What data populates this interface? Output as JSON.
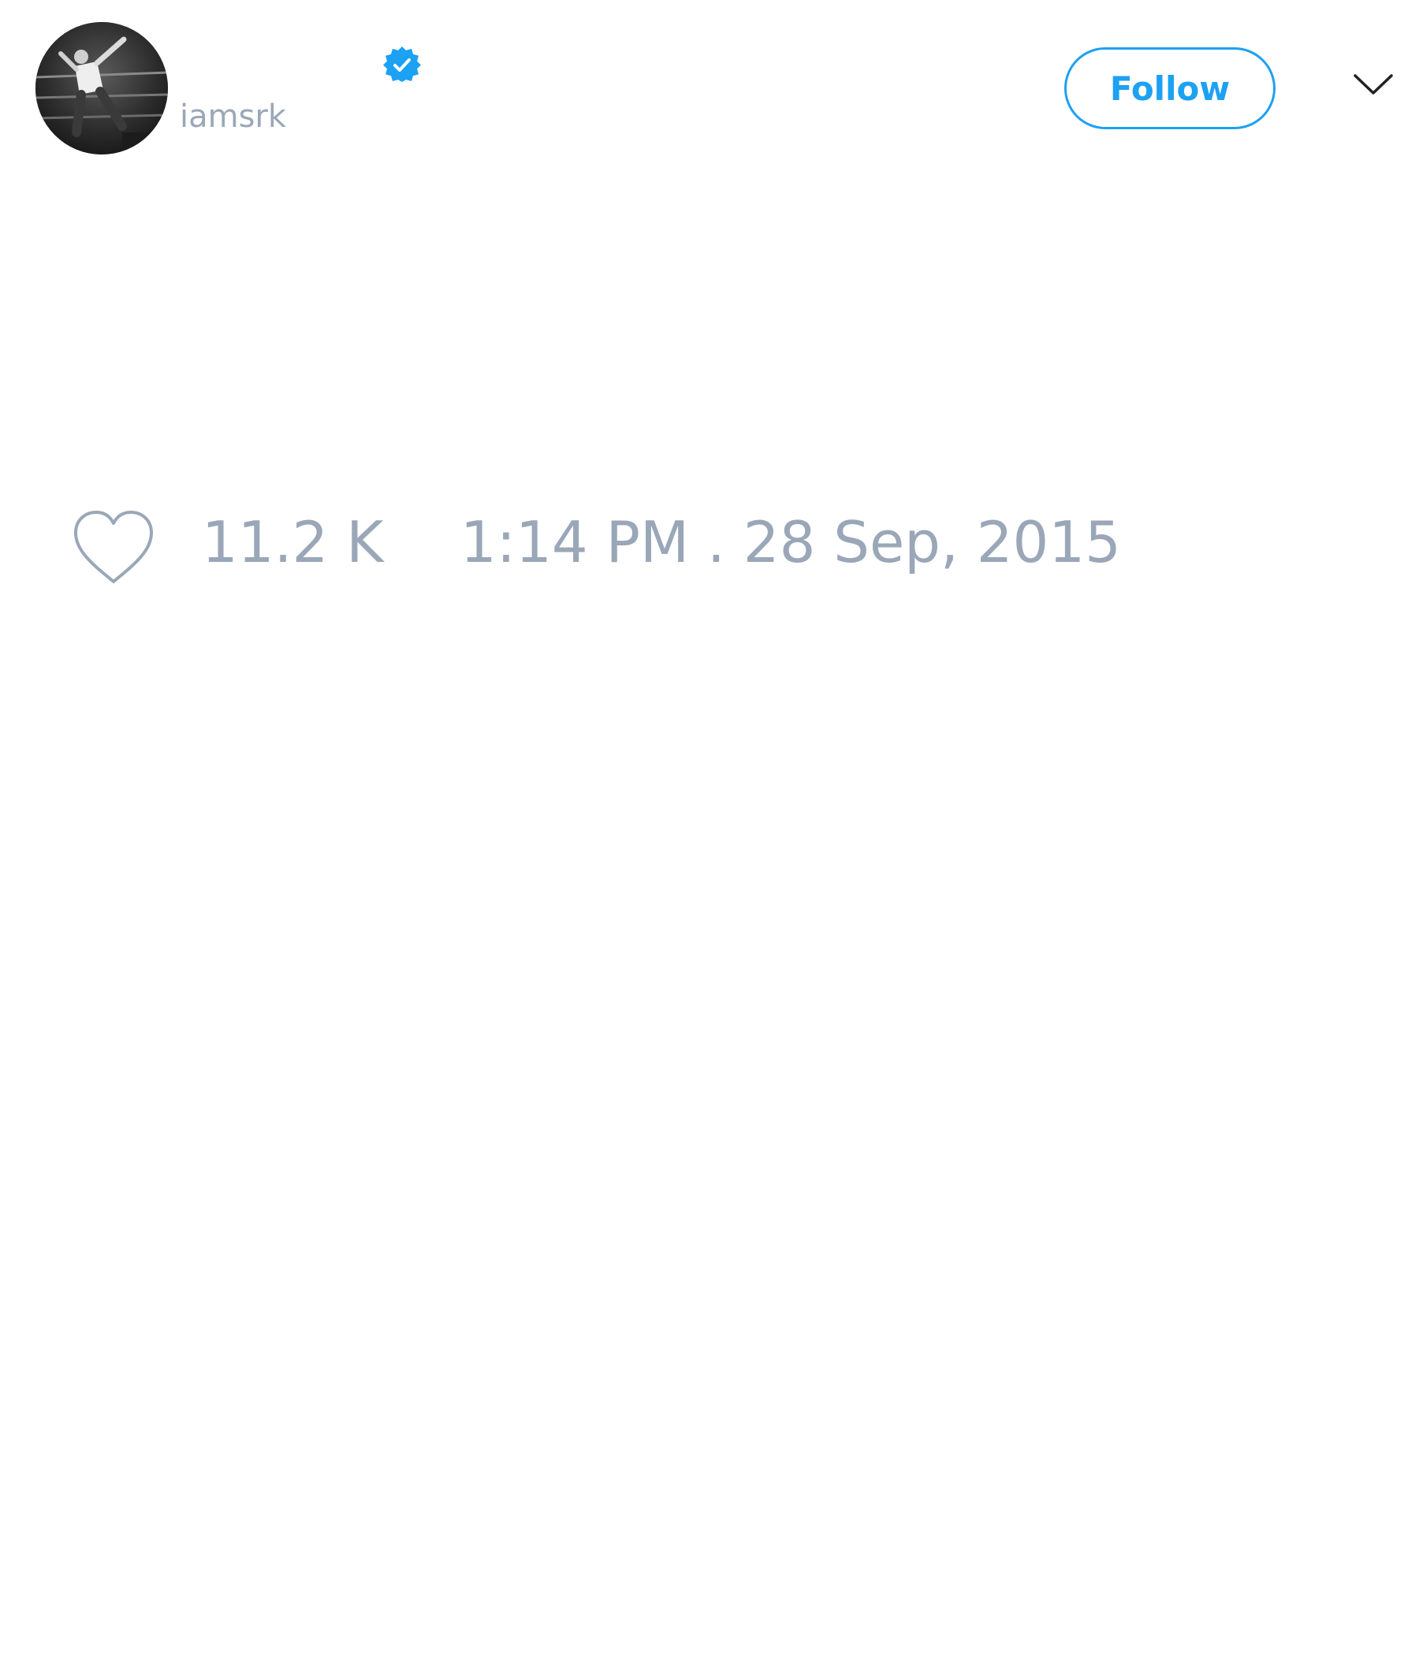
{
  "author": {
    "handle": "iamsrk",
    "verified": true,
    "avatar": "profile-photo"
  },
  "header": {
    "follow_label": "Follow",
    "menu_icon": "chevron-down-icon"
  },
  "actions": {
    "like_icon": "heart-outline-icon",
    "like_count": "11.2 K",
    "timestamp": "1:14 PM . 28 Sep, 2015"
  },
  "colors": {
    "accent": "#1da1f2",
    "muted_text": "#9aa7b8",
    "background": "#ffffff"
  }
}
